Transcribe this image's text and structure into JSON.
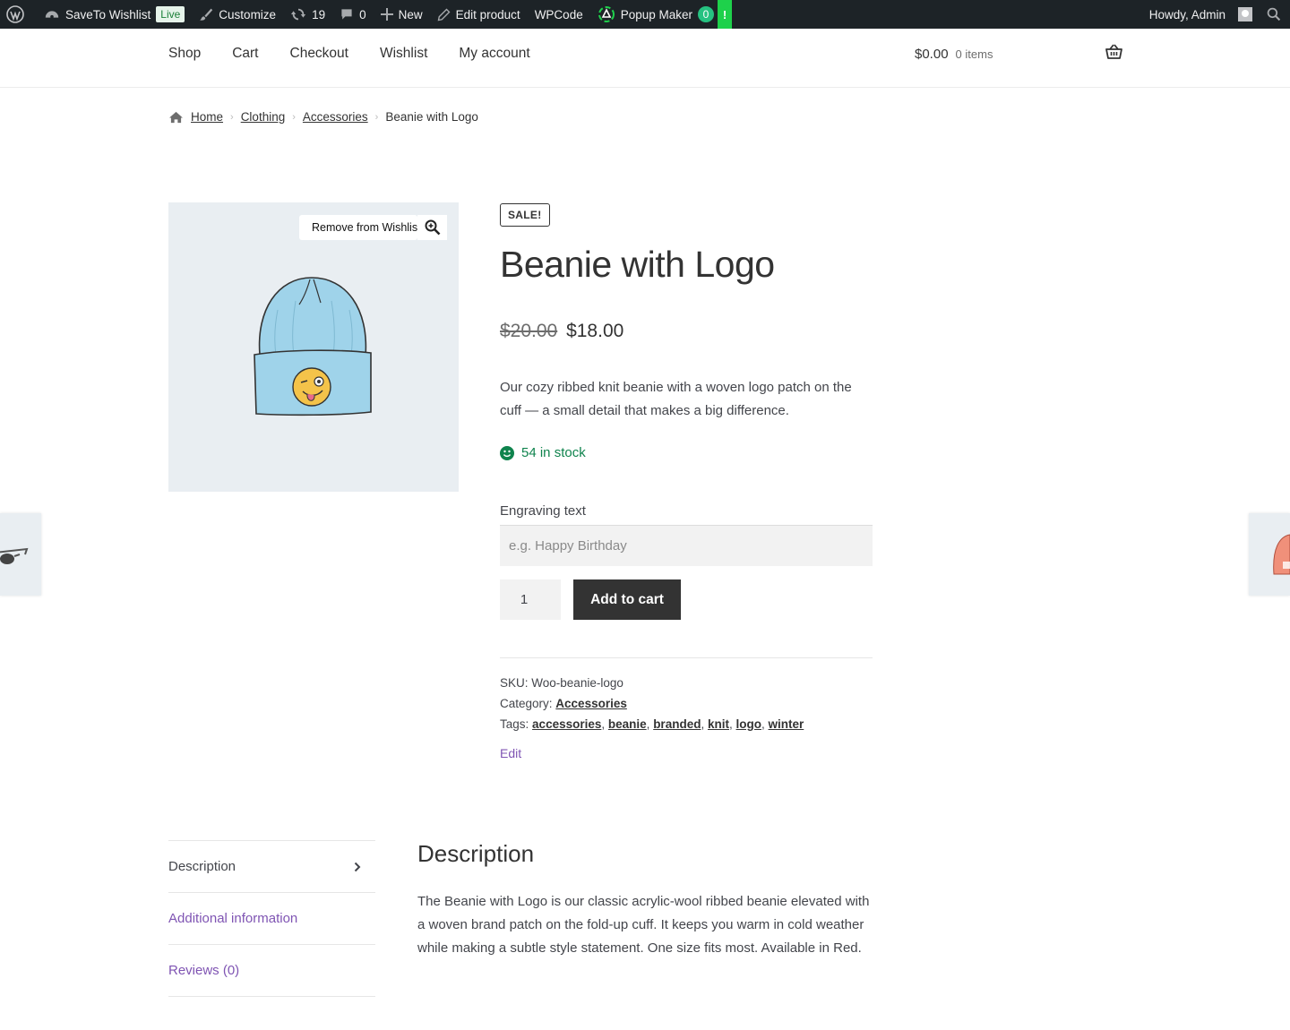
{
  "adminbar": {
    "site_name": "SaveTo Wishlist",
    "live_badge": "Live",
    "customize": "Customize",
    "updates_count": "19",
    "comments_count": "0",
    "new_label": "New",
    "edit_product": "Edit product",
    "wpcode": "WPCode",
    "popup_maker": "Popup Maker",
    "popup_count": "0",
    "alert": "!",
    "howdy": "Howdy, Admin"
  },
  "nav": {
    "items": [
      "Shop",
      "Cart",
      "Checkout",
      "Wishlist",
      "My account"
    ]
  },
  "header_cart": {
    "total": "$0.00",
    "items": "0 items"
  },
  "breadcrumb": {
    "home": "Home",
    "level1": "Clothing",
    "level2": "Accessories",
    "current": "Beanie with Logo"
  },
  "gallery": {
    "wishlist_label": "Remove from Wishlist"
  },
  "product": {
    "sale_badge": "SALE!",
    "title": "Beanie with Logo",
    "old_price": "$20.00",
    "price": "$18.00",
    "short_description": "Our cozy ribbed knit beanie with a woven logo patch on the cuff — a small detail that makes a big difference.",
    "stock": "54 in stock",
    "engraving_label": "Engraving text",
    "engraving_placeholder": "e.g. Happy Birthday",
    "quantity": "1",
    "add_to_cart": "Add to cart",
    "sku_label": "SKU:",
    "sku": "Woo-beanie-logo",
    "category_label": "Category:",
    "category": "Accessories",
    "tags_label": "Tags:",
    "tags": [
      "accessories",
      "beanie",
      "branded",
      "knit",
      "logo",
      "winter"
    ],
    "edit": "Edit"
  },
  "tabs": {
    "description": "Description",
    "additional": "Additional information",
    "reviews": "Reviews (0)"
  },
  "description": {
    "heading": "Description",
    "body": "The Beanie with Logo is our classic acrylic-wool ribbed beanie elevated with a woven brand patch on the fold-up cuff. It keeps you warm in cold weather while making a subtle style statement. One size fits most. Available in Red."
  },
  "colors": {
    "adminbar_bg": "#1d2327",
    "accent_purple": "#7f54b3",
    "stock_green": "#0f834d",
    "button_dark": "#333333"
  }
}
